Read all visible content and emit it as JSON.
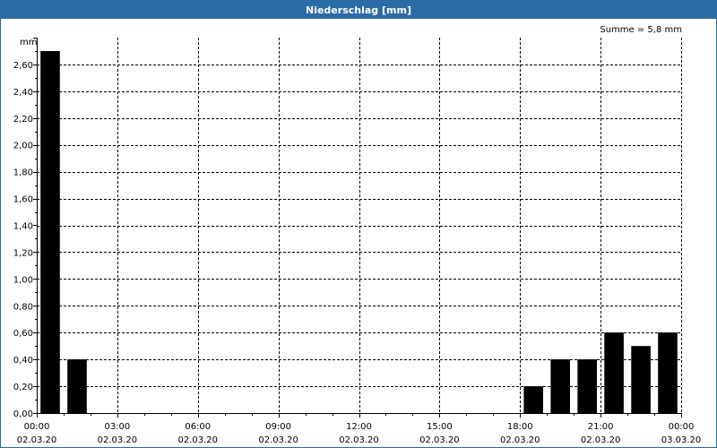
{
  "chart_data": {
    "type": "bar",
    "title": "Niederschlag [mm]",
    "unit": "mm",
    "summary": "Summe = 5,8 mm",
    "ylim": [
      0,
      2.8
    ],
    "yticks": [
      0,
      0.2,
      0.4,
      0.6,
      0.8,
      1.0,
      1.2,
      1.4,
      1.6,
      1.8,
      2.0,
      2.2,
      2.4,
      2.6
    ],
    "ytick_labels": [
      "0,00",
      "0,20",
      "0,40",
      "0,60",
      "0,80",
      "1,00",
      "1,20",
      "1,40",
      "1,60",
      "1,80",
      "2,00",
      "2,20",
      "2,40",
      "2,60"
    ],
    "xlim": [
      0,
      24
    ],
    "xticks": [
      0,
      3,
      6,
      9,
      12,
      15,
      18,
      21,
      24
    ],
    "xtick_labels": [
      [
        "00:00",
        "02.03.20"
      ],
      [
        "03:00",
        "02.03.20"
      ],
      [
        "06:00",
        "02.03.20"
      ],
      [
        "09:00",
        "02.03.20"
      ],
      [
        "12:00",
        "02.03.20"
      ],
      [
        "15:00",
        "02.03.20"
      ],
      [
        "18:00",
        "02.03.20"
      ],
      [
        "21:00",
        "02.03.20"
      ],
      [
        "00:00",
        "03.03.20"
      ]
    ],
    "grid": true,
    "bar_color": "#000000",
    "bars": [
      {
        "x": 0.5,
        "value": 2.7
      },
      {
        "x": 1.5,
        "value": 0.4
      },
      {
        "x": 2.5,
        "value": 0
      },
      {
        "x": 3.5,
        "value": 0
      },
      {
        "x": 4.5,
        "value": 0
      },
      {
        "x": 5.5,
        "value": 0
      },
      {
        "x": 6.5,
        "value": 0
      },
      {
        "x": 7.5,
        "value": 0
      },
      {
        "x": 8.5,
        "value": 0
      },
      {
        "x": 9.5,
        "value": 0
      },
      {
        "x": 10.5,
        "value": 0
      },
      {
        "x": 11.5,
        "value": 0
      },
      {
        "x": 12.5,
        "value": 0
      },
      {
        "x": 13.5,
        "value": 0
      },
      {
        "x": 14.5,
        "value": 0
      },
      {
        "x": 15.5,
        "value": 0
      },
      {
        "x": 16.5,
        "value": 0
      },
      {
        "x": 17.5,
        "value": 0
      },
      {
        "x": 18.5,
        "value": 0.2
      },
      {
        "x": 19.5,
        "value": 0.4
      },
      {
        "x": 20.5,
        "value": 0.4
      },
      {
        "x": 21.5,
        "value": 0.6
      },
      {
        "x": 22.5,
        "value": 0.5
      },
      {
        "x": 23.5,
        "value": 0.6
      }
    ]
  }
}
